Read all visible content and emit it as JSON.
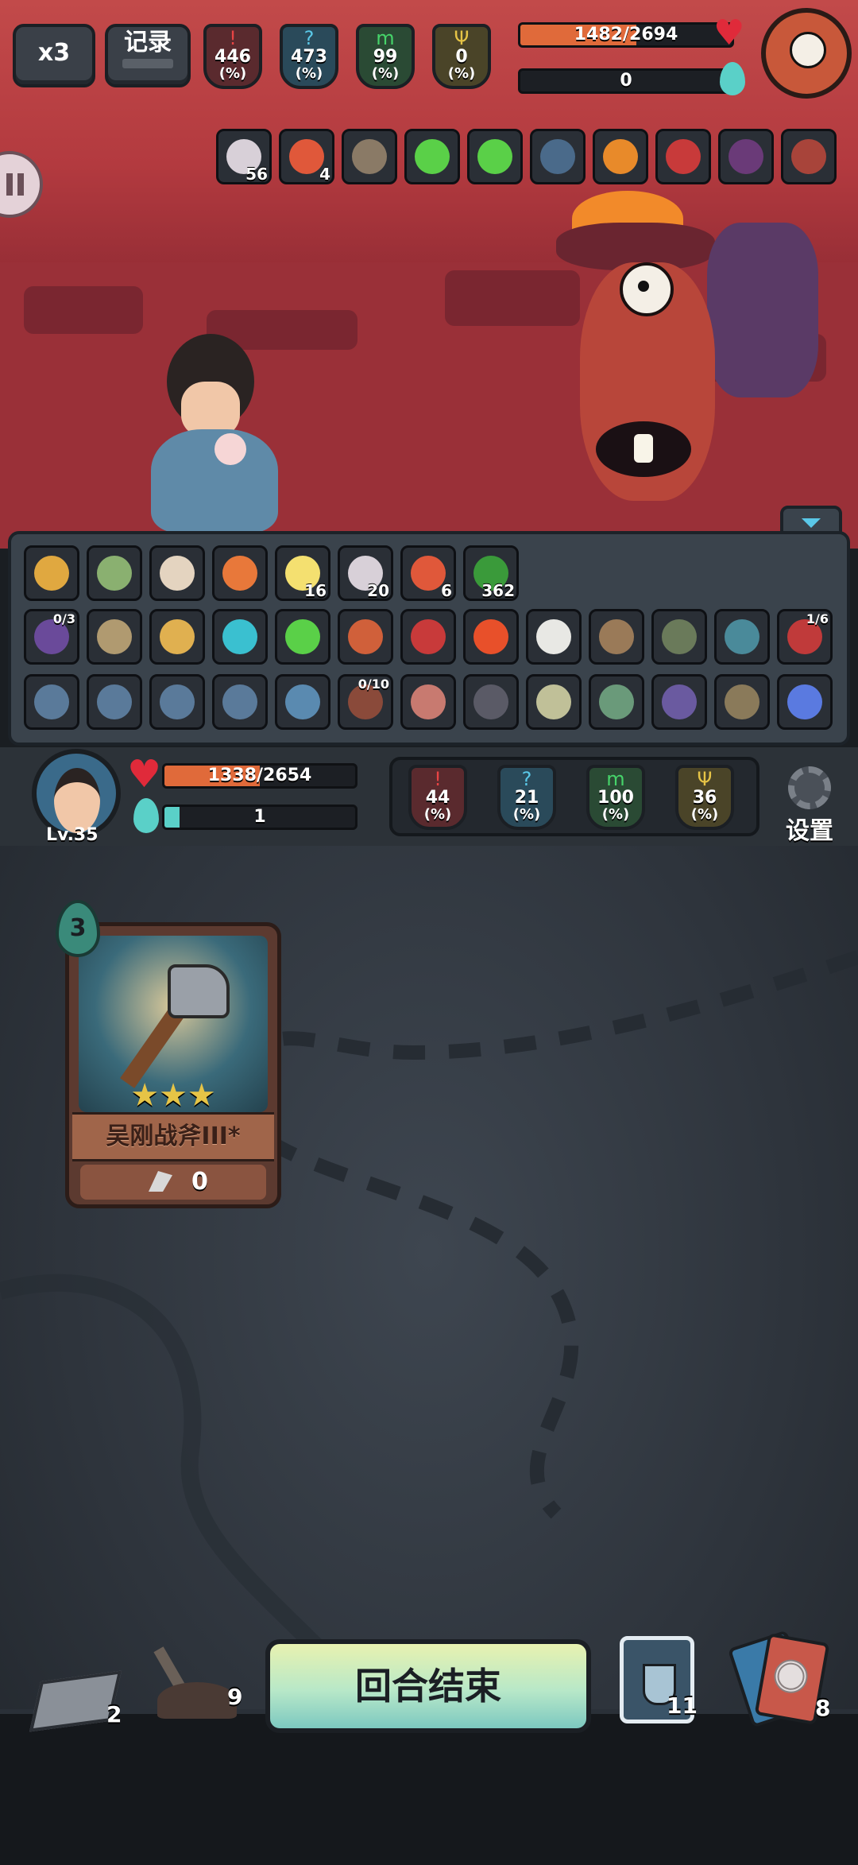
{
  "top_buttons": {
    "speed": "x3",
    "record": "记录"
  },
  "enemy": {
    "stats": [
      {
        "value": "446",
        "unit": "(%)",
        "color": "red"
      },
      {
        "value": "473",
        "unit": "(%)",
        "color": "blue"
      },
      {
        "value": "99",
        "unit": "(%)",
        "color": "green"
      },
      {
        "value": "0",
        "unit": "(%)",
        "color": "gold"
      }
    ],
    "hp_text": "1482/2694",
    "hp_fraction": 0.55,
    "mana_text": "0",
    "buffs": [
      {
        "icon": "swirl-icon",
        "count": "56"
      },
      {
        "icon": "flame-bag-icon",
        "count": "4"
      },
      {
        "icon": "book-icon",
        "count": ""
      },
      {
        "icon": "green-gem-icon",
        "count": ""
      },
      {
        "icon": "green-gem-icon",
        "count": ""
      },
      {
        "icon": "tower-icon",
        "count": ""
      },
      {
        "icon": "fire-sword-icon",
        "count": ""
      },
      {
        "icon": "red-horn-icon",
        "count": ""
      },
      {
        "icon": "purple-horn-icon",
        "count": ""
      },
      {
        "icon": "bead-necklace-icon",
        "count": ""
      }
    ]
  },
  "relics": {
    "row1": [
      {
        "icon": "bread-icon",
        "count": ""
      },
      {
        "icon": "teacup-icon",
        "count": ""
      },
      {
        "icon": "fang-icon",
        "count": ""
      },
      {
        "icon": "torch-icon",
        "count": ""
      },
      {
        "icon": "candle-icon",
        "count": "16"
      },
      {
        "icon": "swirl-icon",
        "count": "20"
      },
      {
        "icon": "flame-bag-icon",
        "count": "6"
      },
      {
        "icon": "green-vine-icon",
        "count": "362"
      }
    ],
    "row2": [
      {
        "icon": "spellbook-icon",
        "tag": "0/3"
      },
      {
        "icon": "scales-icon",
        "tag": ""
      },
      {
        "icon": "scroll-icon",
        "tag": ""
      },
      {
        "icon": "blue-apple-icon",
        "tag": ""
      },
      {
        "icon": "green-gem-icon",
        "tag": ""
      },
      {
        "icon": "gold-book-icon",
        "tag": ""
      },
      {
        "icon": "red-horn-icon",
        "tag": ""
      },
      {
        "icon": "bomb-fruit-icon",
        "tag": ""
      },
      {
        "icon": "rice-ball-icon",
        "tag": ""
      },
      {
        "icon": "shield-icon",
        "tag": ""
      },
      {
        "icon": "ogre-icon",
        "tag": ""
      },
      {
        "icon": "fish-icon",
        "tag": ""
      },
      {
        "icon": "red-tome-icon",
        "tag": "1/6"
      }
    ],
    "row3": [
      {
        "icon": "face-rune-icon",
        "tag": ""
      },
      {
        "icon": "arrow-rune-icon",
        "tag": ""
      },
      {
        "icon": "moon-rune-icon",
        "tag": ""
      },
      {
        "icon": "heart-rune-icon",
        "tag": ""
      },
      {
        "icon": "dash-rune-icon",
        "tag": ""
      },
      {
        "icon": "warrior-icon",
        "tag": "0/10"
      },
      {
        "icon": "ham-icon",
        "tag": ""
      },
      {
        "icon": "hood-icon",
        "tag": ""
      },
      {
        "icon": "rope-icon",
        "tag": ""
      },
      {
        "icon": "hourglass-icon",
        "tag": ""
      },
      {
        "icon": "scorpion-icon",
        "tag": ""
      },
      {
        "icon": "toad-icon",
        "tag": ""
      },
      {
        "icon": "blue-sword-icon",
        "tag": ""
      }
    ]
  },
  "player": {
    "level": "Lv.35",
    "hp_text": "1338/2654",
    "hp_fraction": 0.5,
    "mana_text": "1",
    "mana_fraction": 0.08,
    "stats": [
      {
        "value": "44",
        "unit": "(%)",
        "color": "red"
      },
      {
        "value": "21",
        "unit": "(%)",
        "color": "blue"
      },
      {
        "value": "100",
        "unit": "(%)",
        "color": "green"
      },
      {
        "value": "36",
        "unit": "(%)",
        "color": "gold"
      }
    ],
    "settings_label": "设置"
  },
  "hand": {
    "card": {
      "cost": "3",
      "name": "吴刚战斧III*",
      "value": "0",
      "stars": 3,
      "icon": "axe-icon"
    }
  },
  "bottom": {
    "draw_pile": "2",
    "grave_pile": "9",
    "end_turn_label": "回合结束",
    "potion_count": "11",
    "discard_pile": "8"
  },
  "colors": {
    "hp": "#e06a3a",
    "mana": "#5ad0c8",
    "red_stat": "#e84444",
    "blue_stat": "#5ac8e8",
    "green_stat": "#46d46a",
    "gold_stat": "#e6c446"
  }
}
